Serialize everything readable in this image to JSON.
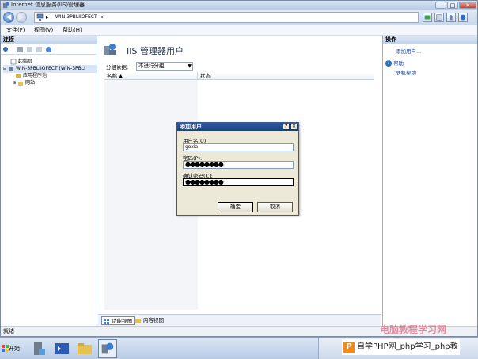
{
  "window": {
    "title": "Internet 信息服务(IIS)管理器",
    "controls": {
      "minimize": "–",
      "maximize": "□",
      "close": "✕"
    }
  },
  "address": {
    "back_glyph": "◀",
    "forward_glyph": "▶",
    "separator": "▸",
    "crumbs": [
      "WIN-3PBLIIOFECT",
      "▸"
    ]
  },
  "menu": {
    "items": [
      "文件(F)",
      "视图(V)",
      "帮助(H)"
    ]
  },
  "connections": {
    "header": "连接",
    "tree": [
      {
        "label": "起始页",
        "icon": "start-page-icon"
      },
      {
        "label": "WIN-3PBLIIOFECT (WIN-3PBLI",
        "icon": "server-icon"
      },
      {
        "label": "应用程序池",
        "icon": "app-pools-icon"
      },
      {
        "label": "网站",
        "icon": "sites-icon"
      }
    ]
  },
  "main": {
    "title": "IIS 管理器用户",
    "group_label": "分组依据:",
    "group_value": "不进行分组",
    "columns": [
      "名称 ▲",
      "状态"
    ],
    "tabs": [
      "功能视图",
      "内容视图"
    ]
  },
  "actions": {
    "header": "操作",
    "items": [
      "添加用户...",
      "帮助",
      "联机帮助"
    ]
  },
  "status": {
    "text": "就绪"
  },
  "dialog": {
    "title": "添加用户",
    "help_glyph": "?",
    "close_glyph": "✕",
    "username_label": "用户名(U):",
    "username_value": "goxia",
    "password_label": "密码(P):",
    "password_value": "●●●●●●●●",
    "confirm_label": "确认密码(C):",
    "confirm_value": "●●●●●●●●",
    "ok_label": "确定",
    "cancel_label": "取消"
  },
  "taskbar": {
    "start_label": "开始"
  },
  "watermark": {
    "text": "自学PHP网_php学习_php教",
    "logo": "P",
    "overlay": "电脑教程学习网"
  },
  "colors": {
    "accent": "#1d3f7d",
    "link": "#1b4aa0"
  }
}
